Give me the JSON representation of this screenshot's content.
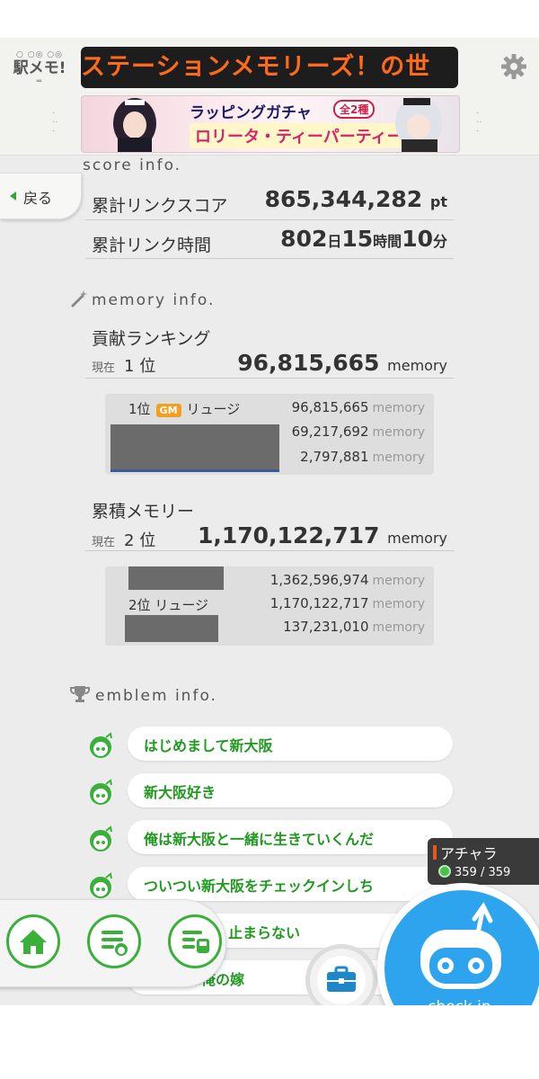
{
  "header": {
    "logo_text": "駅メモ!",
    "marquee_text": "ステーションメモリーズ！の世",
    "banner": {
      "title1": "ラッピングガチャ",
      "tag": "全2種",
      "title2": "ロリータ・ティーパーティー"
    }
  },
  "back_label": "戻る",
  "score_info": {
    "heading": "score info.",
    "total_score_label": "累計リンクスコア",
    "total_score_value": "865,344,282",
    "total_score_unit": "pt",
    "total_time_label": "累計リンク時間",
    "days": "802",
    "days_unit": "日",
    "hours": "15",
    "hours_unit": "時間",
    "minutes": "10",
    "minutes_unit": "分"
  },
  "memory_info": {
    "heading": "memory info.",
    "contribution": {
      "title": "貢献ランキング",
      "current_label": "現在",
      "rank": "1",
      "rank_unit": "位",
      "value": "96,815,665",
      "unit": "memory",
      "rows": [
        {
          "rank": "1位",
          "badge": "GM",
          "name": "リュージ",
          "value": "96,815,665",
          "unit": "memory"
        },
        {
          "rank": "",
          "badge": "",
          "name": "",
          "value": "69,217,692",
          "unit": "memory"
        },
        {
          "rank": "",
          "badge": "",
          "name": "",
          "value": "2,797,881",
          "unit": "memory"
        }
      ]
    },
    "cumulative": {
      "title": "累積メモリー",
      "current_label": "現在",
      "rank": "2",
      "rank_unit": "位",
      "value": "1,170,122,717",
      "unit": "memory",
      "rows": [
        {
          "rank": "",
          "name": "",
          "value": "1,362,596,974",
          "unit": "memory"
        },
        {
          "rank": "2位",
          "name": "リュージ",
          "value": "1,170,122,717",
          "unit": "memory"
        },
        {
          "rank": "",
          "name": "",
          "value": "137,231,010",
          "unit": "memory"
        }
      ]
    }
  },
  "emblem_info": {
    "heading": "emblem info.",
    "items": [
      "はじめまして新大阪",
      "新大阪好き",
      "俺は新大阪と一緒に生きていくんだ",
      "ついつい新大阪をチェックインしち",
      "止まらない",
      "阪は俺の嫁"
    ]
  },
  "character": {
    "name": "アチャラ",
    "hp": "359 / 359"
  },
  "checkin_label": "check in",
  "colors": {
    "accent_green": "#3ab03a",
    "checkin_blue": "#2ea4ee",
    "marquee_orange": "#ff6a1a"
  }
}
